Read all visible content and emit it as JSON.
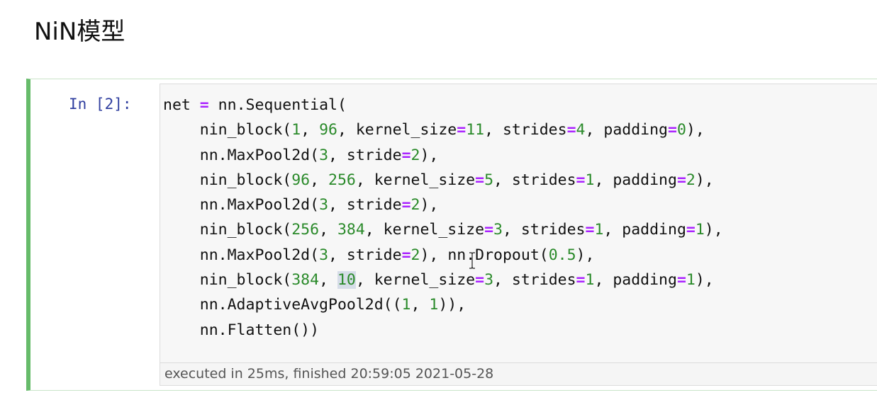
{
  "heading": "NiN模型",
  "cell": {
    "prompt": "In [2]:",
    "code_lines": [
      [
        {
          "t": "net ",
          "k": "plain"
        },
        {
          "t": "=",
          "k": "op"
        },
        {
          "t": " nn.Sequential(",
          "k": "plain"
        }
      ],
      [
        {
          "t": "    nin_block(",
          "k": "plain"
        },
        {
          "t": "1",
          "k": "num"
        },
        {
          "t": ", ",
          "k": "plain"
        },
        {
          "t": "96",
          "k": "num"
        },
        {
          "t": ", kernel_size",
          "k": "plain"
        },
        {
          "t": "=",
          "k": "op"
        },
        {
          "t": "11",
          "k": "num"
        },
        {
          "t": ", strides",
          "k": "plain"
        },
        {
          "t": "=",
          "k": "op"
        },
        {
          "t": "4",
          "k": "num"
        },
        {
          "t": ", padding",
          "k": "plain"
        },
        {
          "t": "=",
          "k": "op"
        },
        {
          "t": "0",
          "k": "num"
        },
        {
          "t": "),",
          "k": "plain"
        }
      ],
      [
        {
          "t": "    nn.MaxPool2d(",
          "k": "plain"
        },
        {
          "t": "3",
          "k": "num"
        },
        {
          "t": ", stride",
          "k": "plain"
        },
        {
          "t": "=",
          "k": "op"
        },
        {
          "t": "2",
          "k": "num"
        },
        {
          "t": "),",
          "k": "plain"
        }
      ],
      [
        {
          "t": "    nin_block(",
          "k": "plain"
        },
        {
          "t": "96",
          "k": "num"
        },
        {
          "t": ", ",
          "k": "plain"
        },
        {
          "t": "256",
          "k": "num"
        },
        {
          "t": ", kernel_size",
          "k": "plain"
        },
        {
          "t": "=",
          "k": "op"
        },
        {
          "t": "5",
          "k": "num"
        },
        {
          "t": ", strides",
          "k": "plain"
        },
        {
          "t": "=",
          "k": "op"
        },
        {
          "t": "1",
          "k": "num"
        },
        {
          "t": ", padding",
          "k": "plain"
        },
        {
          "t": "=",
          "k": "op"
        },
        {
          "t": "2",
          "k": "num"
        },
        {
          "t": "),",
          "k": "plain"
        }
      ],
      [
        {
          "t": "    nn.MaxPool2d(",
          "k": "plain"
        },
        {
          "t": "3",
          "k": "num"
        },
        {
          "t": ", stride",
          "k": "plain"
        },
        {
          "t": "=",
          "k": "op"
        },
        {
          "t": "2",
          "k": "num"
        },
        {
          "t": "),",
          "k": "plain"
        }
      ],
      [
        {
          "t": "    nin_block(",
          "k": "plain"
        },
        {
          "t": "256",
          "k": "num"
        },
        {
          "t": ", ",
          "k": "plain"
        },
        {
          "t": "384",
          "k": "num"
        },
        {
          "t": ", kernel_size",
          "k": "plain"
        },
        {
          "t": "=",
          "k": "op"
        },
        {
          "t": "3",
          "k": "num"
        },
        {
          "t": ", strides",
          "k": "plain"
        },
        {
          "t": "=",
          "k": "op"
        },
        {
          "t": "1",
          "k": "num"
        },
        {
          "t": ", padding",
          "k": "plain"
        },
        {
          "t": "=",
          "k": "op"
        },
        {
          "t": "1",
          "k": "num"
        },
        {
          "t": "),",
          "k": "plain"
        }
      ],
      [
        {
          "t": "    nn.MaxPool2d(",
          "k": "plain"
        },
        {
          "t": "3",
          "k": "num"
        },
        {
          "t": ", stride",
          "k": "plain"
        },
        {
          "t": "=",
          "k": "op"
        },
        {
          "t": "2",
          "k": "num"
        },
        {
          "t": "), nn.Dropout(",
          "k": "plain"
        },
        {
          "t": "0.5",
          "k": "num"
        },
        {
          "t": "),",
          "k": "plain"
        }
      ],
      [
        {
          "t": "    nin_block(",
          "k": "plain"
        },
        {
          "t": "384",
          "k": "num"
        },
        {
          "t": ", ",
          "k": "plain"
        },
        {
          "t": "10",
          "k": "num-hl"
        },
        {
          "t": ", kernel_size",
          "k": "plain"
        },
        {
          "t": "=",
          "k": "op"
        },
        {
          "t": "3",
          "k": "num"
        },
        {
          "t": ", strides",
          "k": "plain"
        },
        {
          "t": "=",
          "k": "op"
        },
        {
          "t": "1",
          "k": "num"
        },
        {
          "t": ", padding",
          "k": "plain"
        },
        {
          "t": "=",
          "k": "op"
        },
        {
          "t": "1",
          "k": "num"
        },
        {
          "t": "),",
          "k": "plain"
        }
      ],
      [
        {
          "t": "    nn.AdaptiveAvgPool2d((",
          "k": "plain"
        },
        {
          "t": "1",
          "k": "num"
        },
        {
          "t": ", ",
          "k": "plain"
        },
        {
          "t": "1",
          "k": "num"
        },
        {
          "t": ")),",
          "k": "plain"
        }
      ],
      [
        {
          "t": "    nn.Flatten())",
          "k": "plain"
        }
      ]
    ],
    "execution_info": "executed in 25ms, finished 20:59:05 2021-05-28"
  },
  "colors": {
    "cell_border_active": "#66bb6a",
    "prompt": "#303f9f",
    "operator": "#aa22ff",
    "number": "#2a8a2a",
    "selection_highlight": "#d6dde8"
  },
  "icons": {
    "mouse_cursor": "text-cursor-icon"
  }
}
